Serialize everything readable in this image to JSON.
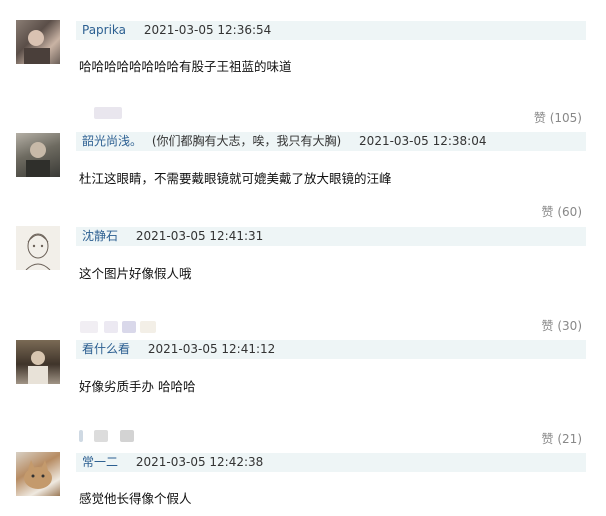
{
  "comments": [
    {
      "username": "Paprika",
      "signature": "",
      "time": "2021-03-05 12:36:54",
      "text": "哈哈哈哈哈哈哈哈有股子王祖蓝的味道",
      "like_label": "",
      "avatar_icon": "user-avatar-photo"
    },
    {
      "username": "韶光尚浅。",
      "signature": "(你们都胸有大志，唉，我只有大胸)",
      "time": "2021-03-05 12:38:04",
      "text": "杜江这眼睛，不需要戴眼镜就可媲美戴了放大眼镜的汪峰",
      "like_label": "赞 (105)",
      "avatar_icon": "user-avatar-photo"
    },
    {
      "username": "沈静石",
      "signature": "",
      "time": "2021-03-05 12:41:31",
      "text": "这个图片好像假人哦",
      "like_label": "赞 (60)",
      "avatar_icon": "user-avatar-sketch"
    },
    {
      "username": "看什么看",
      "signature": "",
      "time": "2021-03-05 12:41:12",
      "text": "好像劣质手办 哈哈哈",
      "like_label": "赞 (30)",
      "avatar_icon": "user-avatar-photo"
    },
    {
      "username": "常一二",
      "signature": "",
      "time": "2021-03-05 12:42:38",
      "text": "感觉他长得像个假人",
      "like_label": "赞 (21)",
      "avatar_icon": "user-avatar-cat"
    }
  ],
  "colors": {
    "meta_bar": "#eef5f6",
    "username": "#2c5f91",
    "like": "#888888"
  }
}
